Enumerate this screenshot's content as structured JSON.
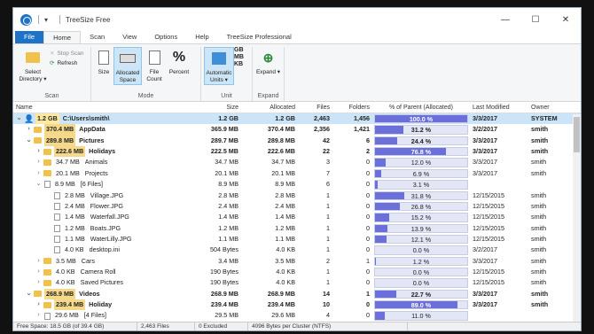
{
  "window": {
    "title": "TreeSize Free",
    "qa_menu": "▾",
    "controls": [
      "—",
      "☐",
      "✕"
    ]
  },
  "tabs": [
    "File",
    "Home",
    "Scan",
    "View",
    "Options",
    "Help",
    "TreeSize Professional"
  ],
  "ribbon": {
    "scan": {
      "select_directory": "Select Directory ▾",
      "stop_scan": "Stop Scan",
      "refresh": "Refresh",
      "label": "Scan"
    },
    "mode": {
      "size": "Size",
      "allocated_space": "Allocated Space",
      "file_count": "File Count",
      "percent": "Percent",
      "label": "Mode"
    },
    "unit": {
      "automatic_units": "Automatic Units ▾",
      "gb": "GB",
      "mb": "MB",
      "kb": "KB",
      "label": "Unit"
    },
    "expand": {
      "expand": "Expand ▾",
      "label": "Expand"
    }
  },
  "columns": [
    "Name",
    "Size",
    "Allocated",
    "Files",
    "Folders",
    "% of Parent (Allocated)",
    "Last Modified",
    "Owner"
  ],
  "rows": [
    {
      "indent": 0,
      "exp": "⌄",
      "icon": "drive",
      "tag": "1.2 GB",
      "name": "C:\\Users\\smith\\",
      "size": "1.2 GB",
      "alloc": "1.2 GB",
      "files": "2,463",
      "folders": "1,456",
      "pct": "100.0 %",
      "pct_val": 1.0,
      "mod": "3/3/2017",
      "owner": "SYSTEM",
      "sel": true,
      "bold": true
    },
    {
      "indent": 1,
      "exp": "›",
      "icon": "folder",
      "tag": "370.4 MB",
      "name": "AppData",
      "size": "365.9 MB",
      "alloc": "370.4 MB",
      "files": "2,356",
      "folders": "1,421",
      "pct": "31.2 %",
      "pct_val": 0.312,
      "mod": "3/2/2017",
      "owner": "smith",
      "bold": true
    },
    {
      "indent": 1,
      "exp": "⌄",
      "icon": "folder",
      "tag": "289.8 MB",
      "name": "Pictures",
      "size": "289.7 MB",
      "alloc": "289.8 MB",
      "files": "42",
      "folders": "6",
      "pct": "24.4 %",
      "pct_val": 0.244,
      "mod": "3/3/2017",
      "owner": "smith",
      "bold": true
    },
    {
      "indent": 2,
      "exp": "›",
      "icon": "folder",
      "tag": "222.6 MB",
      "name": "Holidays",
      "size": "222.5 MB",
      "alloc": "222.6 MB",
      "files": "22",
      "folders": "2",
      "pct": "76.8 %",
      "pct_val": 0.768,
      "mod": "3/3/2017",
      "owner": "smith",
      "bold": true
    },
    {
      "indent": 2,
      "exp": "›",
      "icon": "folder",
      "tag": "34.7 MB",
      "name": "Animals",
      "size": "34.7 MB",
      "alloc": "34.7 MB",
      "files": "3",
      "folders": "0",
      "pct": "12.0 %",
      "pct_val": 0.12,
      "mod": "3/3/2017",
      "owner": "smith"
    },
    {
      "indent": 2,
      "exp": "›",
      "icon": "folder",
      "tag": "20.1 MB",
      "name": "Projects",
      "size": "20.1 MB",
      "alloc": "20.1 MB",
      "files": "7",
      "folders": "0",
      "pct": "6.9 %",
      "pct_val": 0.069,
      "mod": "3/3/2017",
      "owner": "smith"
    },
    {
      "indent": 2,
      "exp": "⌄",
      "icon": "file",
      "tag": "8.9 MB",
      "name": "[6 Files]",
      "size": "8.9 MB",
      "alloc": "8.9 MB",
      "files": "6",
      "folders": "0",
      "pct": "3.1 %",
      "pct_val": 0.031,
      "mod": "",
      "owner": ""
    },
    {
      "indent": 3,
      "exp": "",
      "icon": "file",
      "tag": "2.8 MB",
      "name": "Village.JPG",
      "size": "2.8 MB",
      "alloc": "2.8 MB",
      "files": "1",
      "folders": "0",
      "pct": "31.8 %",
      "pct_val": 0.318,
      "mod": "12/15/2015",
      "owner": "smith"
    },
    {
      "indent": 3,
      "exp": "",
      "icon": "file",
      "tag": "2.4 MB",
      "name": "Flower.JPG",
      "size": "2.4 MB",
      "alloc": "2.4 MB",
      "files": "1",
      "folders": "0",
      "pct": "26.8 %",
      "pct_val": 0.268,
      "mod": "12/15/2015",
      "owner": "smith"
    },
    {
      "indent": 3,
      "exp": "",
      "icon": "file",
      "tag": "1.4 MB",
      "name": "Waterfall.JPG",
      "size": "1.4 MB",
      "alloc": "1.4 MB",
      "files": "1",
      "folders": "0",
      "pct": "15.2 %",
      "pct_val": 0.152,
      "mod": "12/15/2015",
      "owner": "smith"
    },
    {
      "indent": 3,
      "exp": "",
      "icon": "file",
      "tag": "1.2 MB",
      "name": "Boats.JPG",
      "size": "1.2 MB",
      "alloc": "1.2 MB",
      "files": "1",
      "folders": "0",
      "pct": "13.9 %",
      "pct_val": 0.139,
      "mod": "12/15/2015",
      "owner": "smith"
    },
    {
      "indent": 3,
      "exp": "",
      "icon": "file",
      "tag": "1.1 MB",
      "name": "WaterLilly.JPG",
      "size": "1.1 MB",
      "alloc": "1.1 MB",
      "files": "1",
      "folders": "0",
      "pct": "12.1 %",
      "pct_val": 0.121,
      "mod": "12/15/2015",
      "owner": "smith"
    },
    {
      "indent": 3,
      "exp": "",
      "icon": "file",
      "tag": "4.0 KB",
      "name": "desktop.ini",
      "size": "504 Bytes",
      "alloc": "4.0 KB",
      "files": "1",
      "folders": "0",
      "pct": "0.0 %",
      "pct_val": 0.0,
      "mod": "3/2/2017",
      "owner": "smith"
    },
    {
      "indent": 2,
      "exp": "›",
      "icon": "folder",
      "tag": "3.5 MB",
      "name": "Cars",
      "size": "3.4 MB",
      "alloc": "3.5 MB",
      "files": "2",
      "folders": "1",
      "pct": "1.2 %",
      "pct_val": 0.012,
      "mod": "3/3/2017",
      "owner": "smith"
    },
    {
      "indent": 2,
      "exp": "›",
      "icon": "folder",
      "tag": "4.0 KB",
      "name": "Camera Roll",
      "size": "190 Bytes",
      "alloc": "4.0 KB",
      "files": "1",
      "folders": "0",
      "pct": "0.0 %",
      "pct_val": 0.0,
      "mod": "12/15/2015",
      "owner": "smith"
    },
    {
      "indent": 2,
      "exp": "›",
      "icon": "folder",
      "tag": "4.0 KB",
      "name": "Saved Pictures",
      "size": "190 Bytes",
      "alloc": "4.0 KB",
      "files": "1",
      "folders": "0",
      "pct": "0.0 %",
      "pct_val": 0.0,
      "mod": "12/15/2015",
      "owner": "smith"
    },
    {
      "indent": 1,
      "exp": "⌄",
      "icon": "folder",
      "tag": "268.9 MB",
      "name": "Videos",
      "size": "268.9 MB",
      "alloc": "268.9 MB",
      "files": "14",
      "folders": "1",
      "pct": "22.7 %",
      "pct_val": 0.227,
      "mod": "3/3/2017",
      "owner": "smith",
      "bold": true
    },
    {
      "indent": 2,
      "exp": "›",
      "icon": "folder",
      "tag": "239.4 MB",
      "name": "Holiday",
      "size": "239.4 MB",
      "alloc": "239.4 MB",
      "files": "10",
      "folders": "0",
      "pct": "89.0 %",
      "pct_val": 0.89,
      "mod": "3/3/2017",
      "owner": "smith",
      "bold": true
    },
    {
      "indent": 2,
      "exp": "›",
      "icon": "file",
      "tag": "29.6 MB",
      "name": "[4 Files]",
      "size": "29.5 MB",
      "alloc": "29.6 MB",
      "files": "4",
      "folders": "0",
      "pct": "11.0 %",
      "pct_val": 0.11,
      "mod": "",
      "owner": ""
    }
  ],
  "status": [
    "Free Space: 18.5 GB  (of 39.4 GB)",
    "2,463  Files",
    "0 Excluded",
    "4096  Bytes per Cluster (NTFS)"
  ],
  "colors": {
    "accent": "#1e73c8",
    "selection": "#cce4f7",
    "bar": "#6a6fd9",
    "folder": "#f0c24b"
  }
}
